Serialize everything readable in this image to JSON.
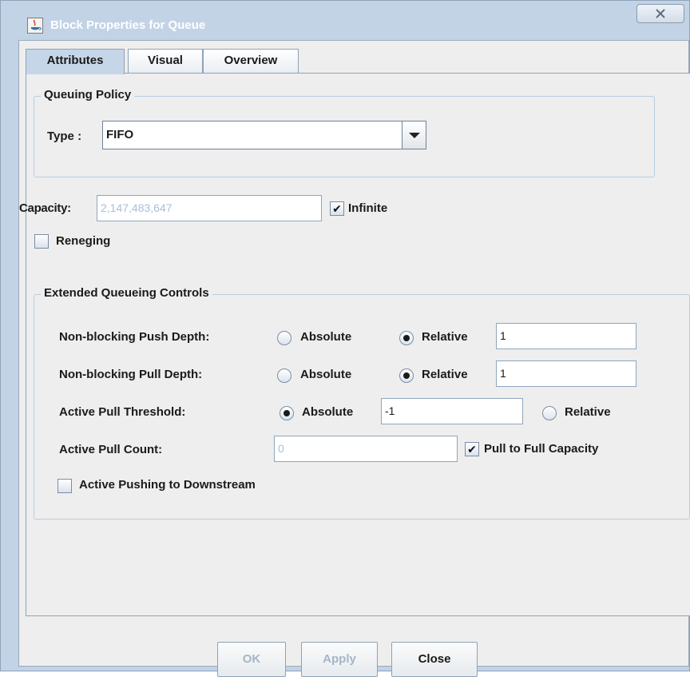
{
  "window": {
    "title": "Block Properties for Queue"
  },
  "tabs": [
    "Attributes",
    "Visual",
    "Overview"
  ],
  "queuing_policy": {
    "group_title": "Queuing Policy",
    "type_label": "Type :",
    "type_value": "FIFO"
  },
  "capacity": {
    "label": "Capacity:",
    "value": "2,147,483,647",
    "infinite_label": "Infinite",
    "infinite_checked": true
  },
  "reneging": {
    "label": "Reneging",
    "checked": false
  },
  "extended": {
    "group_title": "Extended Queueing Controls",
    "push_depth": {
      "label": "Non-blocking Push Depth:",
      "absolute_label": "Absolute",
      "relative_label": "Relative",
      "selected": "Relative",
      "value": "1"
    },
    "pull_depth": {
      "label": "Non-blocking Pull Depth:",
      "absolute_label": "Absolute",
      "relative_label": "Relative",
      "selected": "Relative",
      "value": "1"
    },
    "pull_threshold": {
      "label": "Active Pull Threshold:",
      "absolute_label": "Absolute",
      "relative_label": "Relative",
      "selected": "Absolute",
      "value": "-1"
    },
    "pull_count": {
      "label": "Active Pull Count:",
      "value": "0",
      "full_capacity_label": "Pull to Full Capacity",
      "full_capacity_checked": true
    },
    "active_pushing": {
      "label": "Active Pushing to Downstream",
      "checked": false
    }
  },
  "buttons": {
    "ok": "OK",
    "apply": "Apply",
    "close": "Close"
  },
  "colors": {
    "title_bar": "#c2d3e6",
    "panel_bg": "#eeeeee",
    "disabled_text": "#a9bfd6"
  }
}
